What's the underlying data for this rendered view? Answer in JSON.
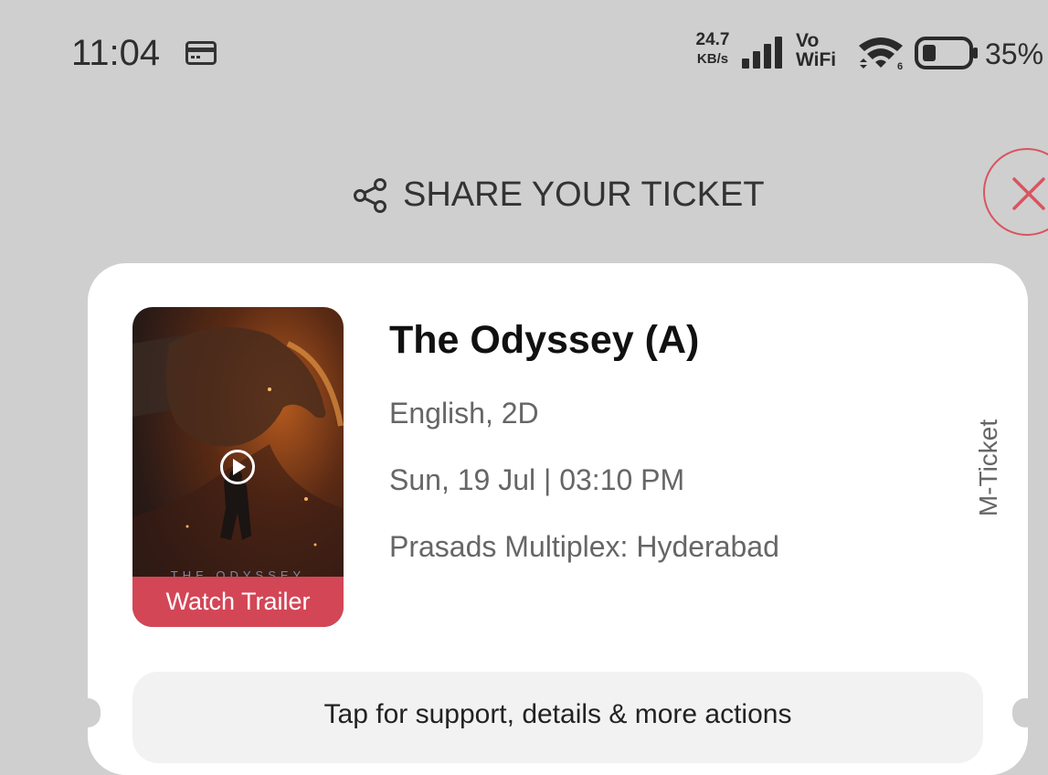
{
  "status_bar": {
    "time": "11:04",
    "net_speed_value": "24.7",
    "net_speed_unit": "KB/s",
    "vowifi_top": "Vo",
    "vowifi_bottom": "WiFi",
    "battery": "35%",
    "icons": [
      "card-icon",
      "signal-icon",
      "wifi-icon",
      "battery-icon"
    ]
  },
  "header": {
    "title": "SHARE YOUR TICKET",
    "share_icon": "share-icon",
    "close_icon": "close-icon"
  },
  "ticket": {
    "poster_title": "THE ODYSSEY",
    "trailer_label": "Watch Trailer",
    "movie_title": "The Odyssey (A)",
    "language_format": "English, 2D",
    "datetime": "Sun, 19 Jul | 03:10 PM",
    "venue": "Prasads Multiplex: Hyderabad",
    "ticket_type": "M-Ticket",
    "support_text": "Tap for support, details & more actions"
  },
  "colors": {
    "background": "#cfcfcf",
    "card": "#ffffff",
    "accent_red": "#d34656",
    "close_red": "#d9545f",
    "support_bg": "#f2f2f2"
  }
}
